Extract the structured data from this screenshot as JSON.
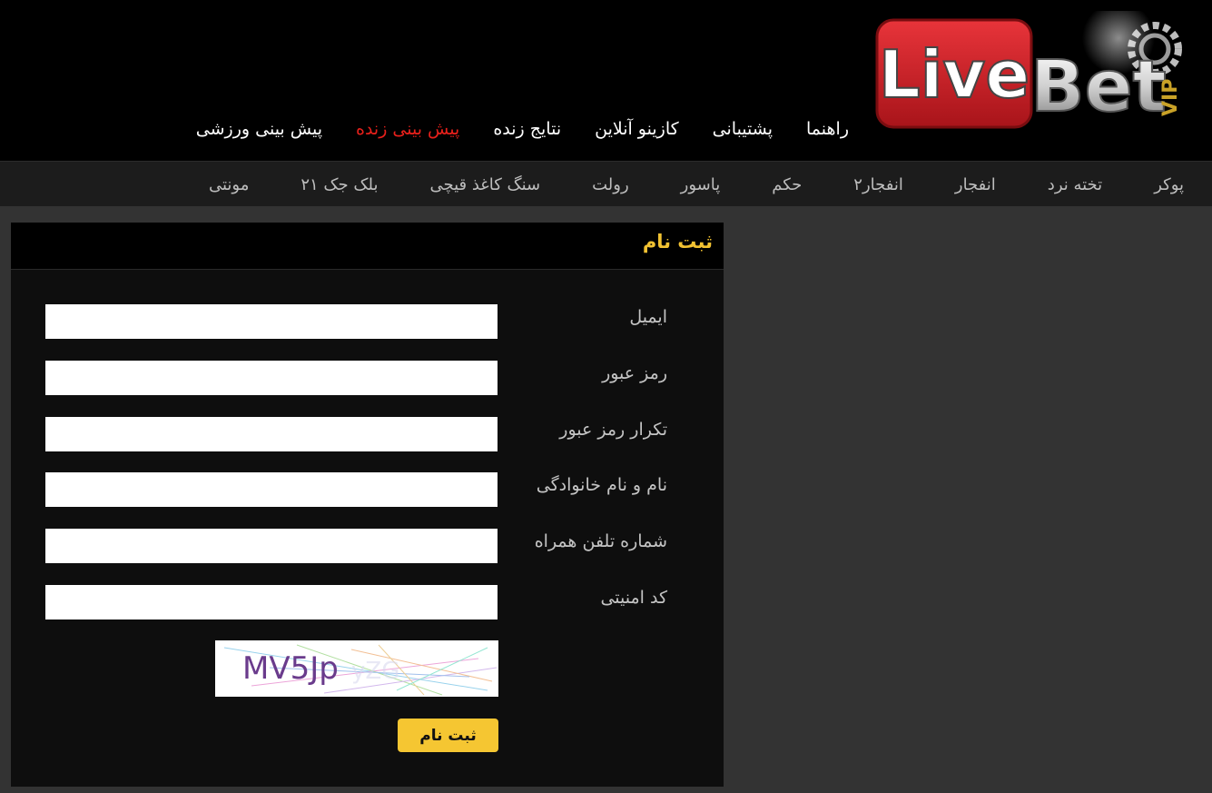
{
  "logo": {
    "part1": "Live",
    "part2": "Bet",
    "part3": "VIP"
  },
  "main_nav": [
    {
      "label": "پیش بینی ورزشی",
      "active": false
    },
    {
      "label": "پیش بینی زنده",
      "active": true
    },
    {
      "label": "نتایج زنده",
      "active": false
    },
    {
      "label": "کازینو آنلاین",
      "active": false
    },
    {
      "label": "پشتیبانی",
      "active": false
    },
    {
      "label": "راهنما",
      "active": false
    }
  ],
  "sub_nav": [
    "پوکر",
    "تخته نرد",
    "انفجار",
    "انفجار۲",
    "حکم",
    "پاسور",
    "رولت",
    "سنگ کاغذ قیچی",
    "بلک جک ۲۱",
    "مونتی"
  ],
  "form": {
    "title": "ثبت نام",
    "fields": [
      {
        "label": "ایمیل",
        "value": ""
      },
      {
        "label": "رمز عبور",
        "value": ""
      },
      {
        "label": "تکرار رمز عبور",
        "value": ""
      },
      {
        "label": "نام و نام خانوادگی",
        "value": ""
      },
      {
        "label": "شماره تلفن همراه",
        "value": ""
      },
      {
        "label": "کد امنیتی",
        "value": ""
      }
    ],
    "captcha_text": "MV5Jp",
    "submit_label": "ثبت نام"
  },
  "colors": {
    "accent_yellow": "#f5c632",
    "title_yellow": "#f2c232",
    "active_red": "#e8201b",
    "logo_red": "#d11f24"
  }
}
